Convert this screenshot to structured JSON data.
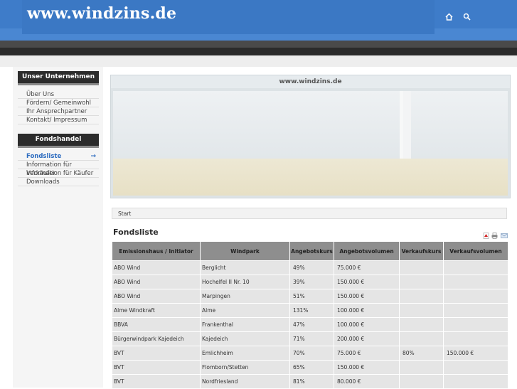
{
  "header": {
    "logo": "www.windzins.de",
    "icons": [
      "home-icon",
      "search-icon"
    ]
  },
  "sidebar": {
    "section1": {
      "title": "Unser Unternehmen",
      "items": [
        "Über Uns",
        "Fördern/ Gemeinwohl",
        "Ihr Ansprechpartner",
        "Kontakt/ Impressum"
      ]
    },
    "section2": {
      "title": "Fondshandel",
      "items": [
        "Fondsliste",
        "Information für Verkäufer",
        "Information für Käufer",
        "Downloads"
      ],
      "active_arrow": "→"
    }
  },
  "banner": {
    "caption": "www.windzins.de"
  },
  "breadcrumb": "Start",
  "page_title": "Fondsliste",
  "title_icons": [
    "pdf-icon",
    "print-icon",
    "email-icon"
  ],
  "table": {
    "headers": [
      "Emissionshaus / Initiator",
      "Windpark",
      "Angebotskurs",
      "Angebotsvolumen",
      "Verkaufskurs",
      "Verkaufsvolumen"
    ],
    "rows": [
      [
        "ABO Wind",
        "Berglicht",
        "49%",
        "75.000 €",
        "",
        ""
      ],
      [
        "ABO Wind",
        "Hochelfel II Nr. 10",
        "39%",
        "150.000 €",
        "",
        ""
      ],
      [
        "ABO Wind",
        "Marpingen",
        "51%",
        "150.000 €",
        "",
        ""
      ],
      [
        "Alme Windkraft",
        "Alme",
        "131%",
        "100.000 €",
        "",
        ""
      ],
      [
        "BBVA",
        "Frankenthal",
        "47%",
        "100.000 €",
        "",
        ""
      ],
      [
        "Bürgerwindpark Kajedeich",
        "Kajedeich",
        "71%",
        "200.000 €",
        "",
        ""
      ],
      [
        "BVT",
        "Emlichheim",
        "70%",
        "75.000 €",
        "80%",
        "150.000 €"
      ],
      [
        "BVT",
        "Flomborn/Stetten",
        "65%",
        "150.000 €",
        "",
        ""
      ],
      [
        "BVT",
        "Nordfriesland",
        "81%",
        "80.000 €",
        "",
        ""
      ]
    ]
  }
}
